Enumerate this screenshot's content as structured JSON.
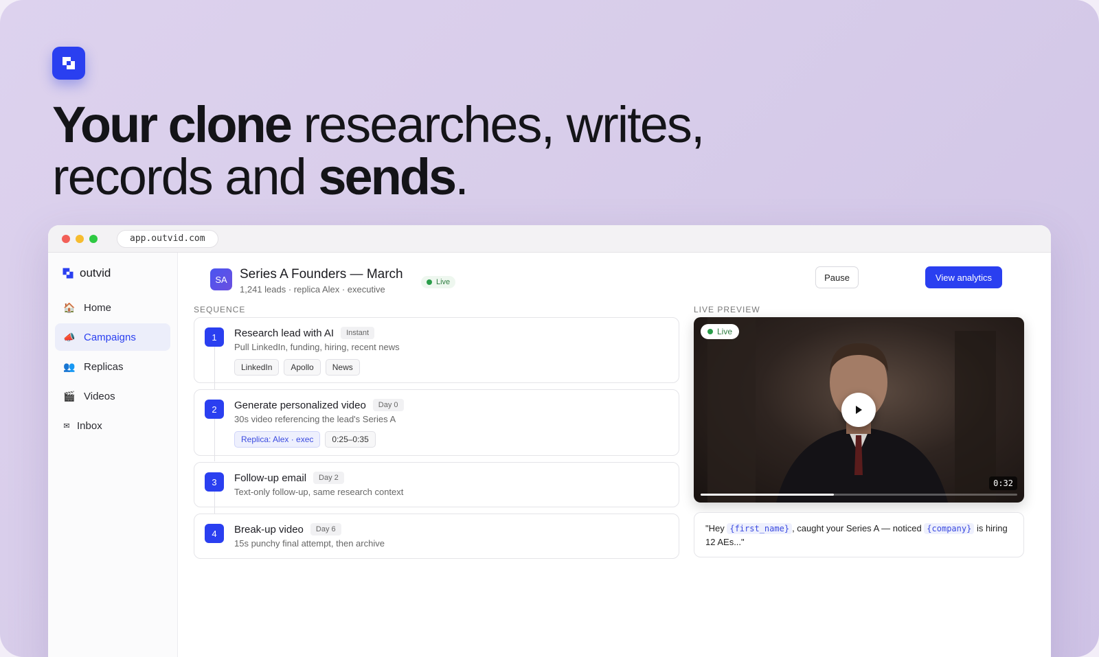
{
  "hero": {
    "line1_bold": "Your clone",
    "line1_rest": " researches, writes,",
    "line2_start": "records and ",
    "line2_bold": "sends",
    "line2_end": "."
  },
  "browser": {
    "url": "app.outvid.com"
  },
  "sidebar": {
    "brand": "outvid",
    "items": [
      {
        "label": "Home",
        "icon": "house-icon"
      },
      {
        "label": "Campaigns",
        "icon": "megaphone-icon",
        "active": true
      },
      {
        "label": "Replicas",
        "icon": "people-icon"
      },
      {
        "label": "Videos",
        "icon": "clapper-icon"
      },
      {
        "label": "Inbox",
        "icon": "envelope-icon"
      }
    ]
  },
  "campaign": {
    "initials": "SA",
    "title": "Series A Founders — March",
    "subtitle": "1,241 leads · replica Alex · executive",
    "status": "Live",
    "pause_label": "Pause",
    "analytics_label": "View analytics"
  },
  "sequence": {
    "label": "SEQUENCE",
    "steps": [
      {
        "num": "1",
        "title": "Research lead with AI",
        "tag": "Instant",
        "desc": "Pull LinkedIn, funding, hiring, recent news",
        "chips": [
          "LinkedIn",
          "Apollo",
          "News"
        ]
      },
      {
        "num": "2",
        "title": "Generate personalized video",
        "tag": "Day 0",
        "desc": "30s video referencing the lead's Series A",
        "chips": [
          "Replica: Alex · exec",
          "0:25–0:35"
        ]
      },
      {
        "num": "3",
        "title": "Follow-up email",
        "tag": "Day 2",
        "desc": "Text-only follow-up, same research context",
        "chips": []
      },
      {
        "num": "4",
        "title": "Break-up video",
        "tag": "Day 6",
        "desc": "15s punchy final attempt, then archive",
        "chips": []
      }
    ]
  },
  "preview": {
    "label": "LIVE PREVIEW",
    "live_badge": "Live",
    "timestamp": "0:32",
    "progress": 0.42,
    "script_open": "\"Hey ",
    "var_first_name": "{first_name}",
    "script_mid": ", caught your Series A — noticed ",
    "var_company": "{company}",
    "script_end": " is hiring 12 AEs...\""
  },
  "colors": {
    "accent": "#2a3ff0",
    "live": "#2a9d4a",
    "background": "#d8cdea"
  }
}
